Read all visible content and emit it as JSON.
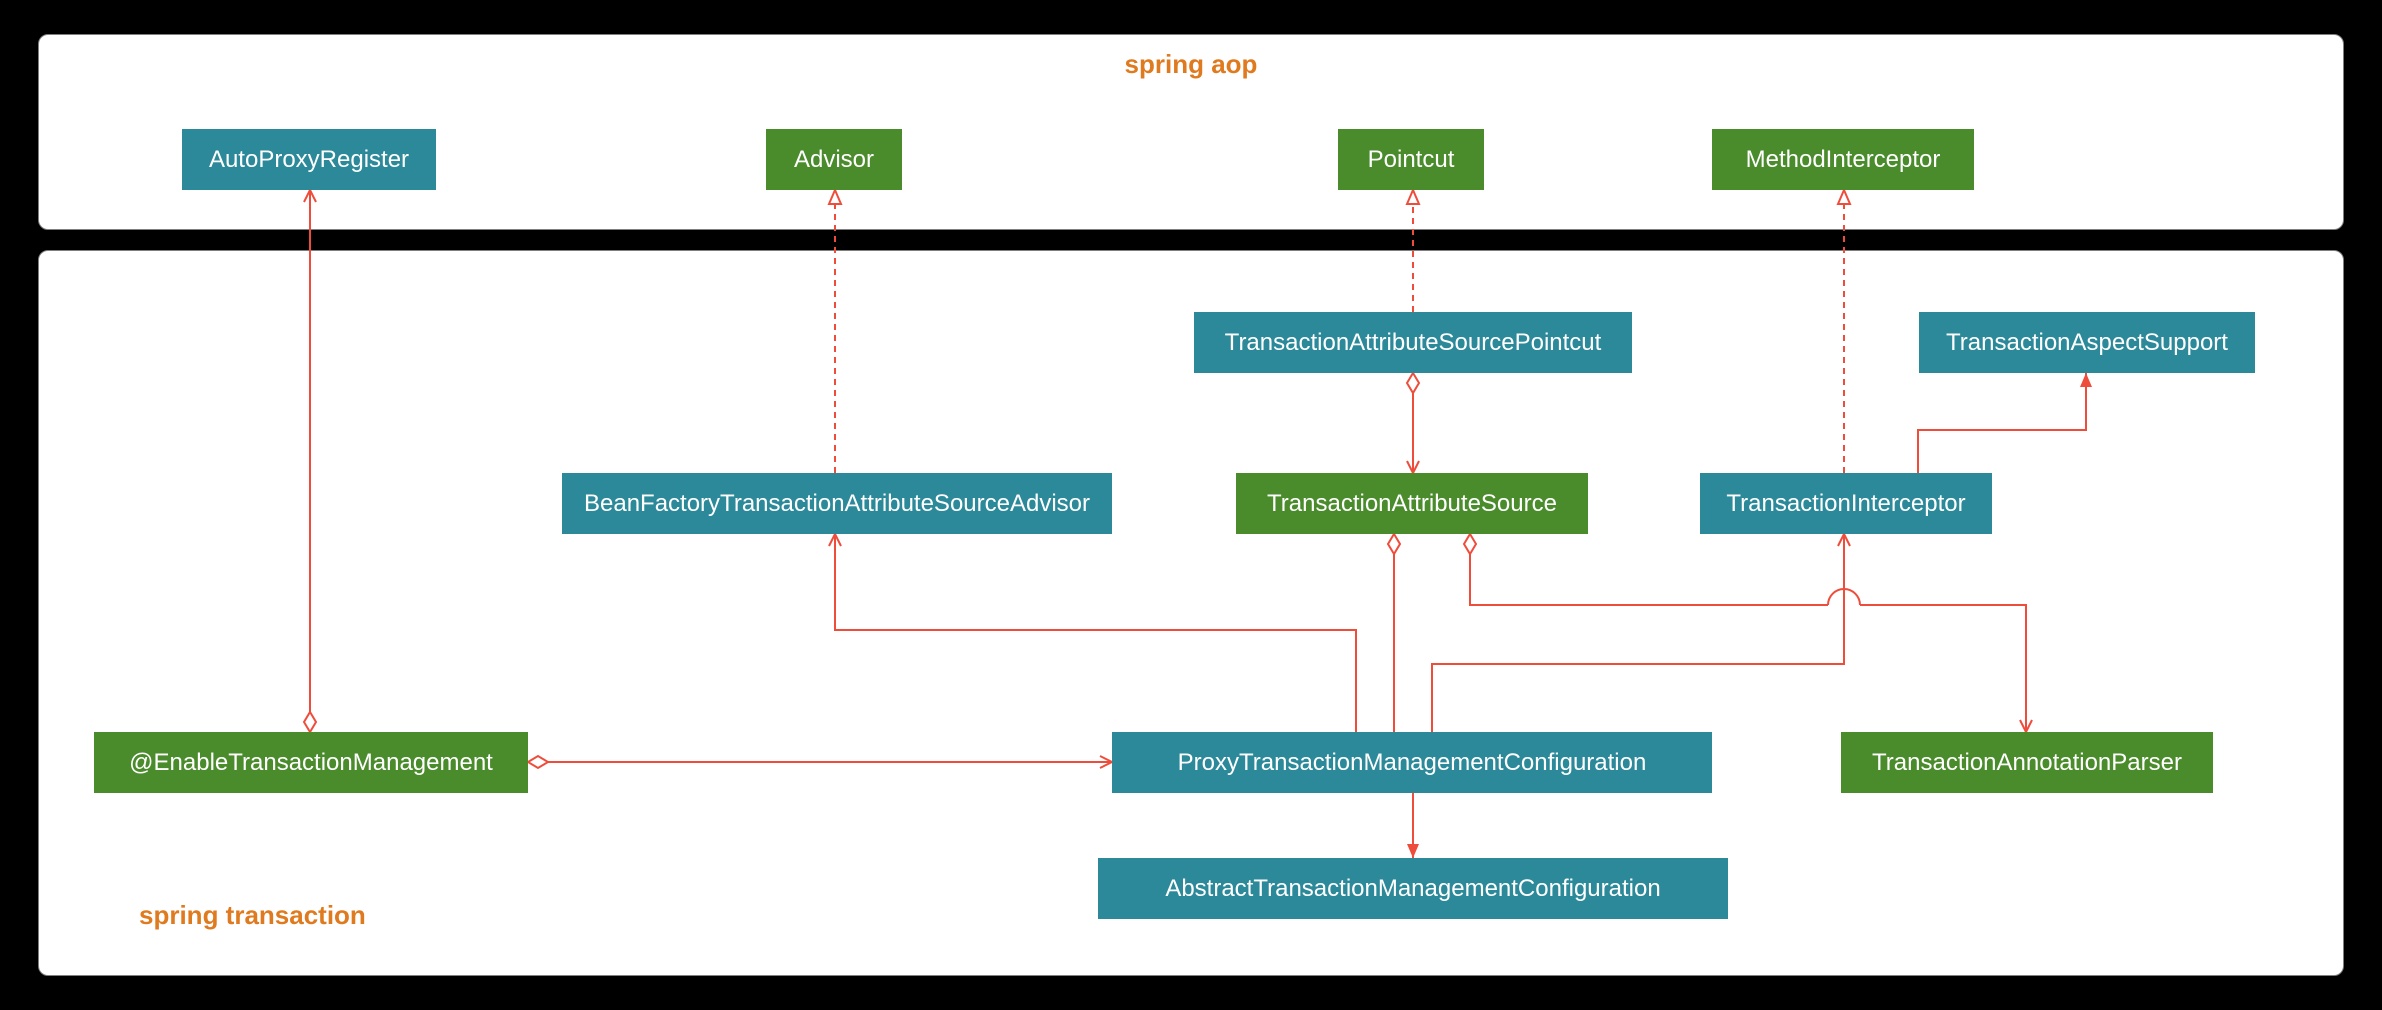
{
  "regions": {
    "aop": {
      "title": "spring aop"
    },
    "tx": {
      "title": "spring transaction"
    }
  },
  "nodes": {
    "autoProxyRegister": "AutoProxyRegister",
    "advisor": "Advisor",
    "pointcut": "Pointcut",
    "methodInterceptor": "MethodInterceptor",
    "txAttrSourcePointcut": "TransactionAttributeSourcePointcut",
    "txAspectSupport": "TransactionAspectSupport",
    "bfTxAttrSourceAdvisor": "BeanFactoryTransactionAttributeSourceAdvisor",
    "txAttrSource": "TransactionAttributeSource",
    "txInterceptor": "TransactionInterceptor",
    "enableTxMgmt": "@EnableTransactionManagement",
    "proxyTxMgmtConfig": "ProxyTransactionManagementConfiguration",
    "txAnnotationParser": "TransactionAnnotationParser",
    "abstractTxMgmtConfig": "AbstractTransactionManagementConfiguration"
  },
  "colors": {
    "teal": "#2b8999",
    "green": "#4a8b2c",
    "orange": "#e07a1f",
    "arrow": "#ef4d3c"
  }
}
